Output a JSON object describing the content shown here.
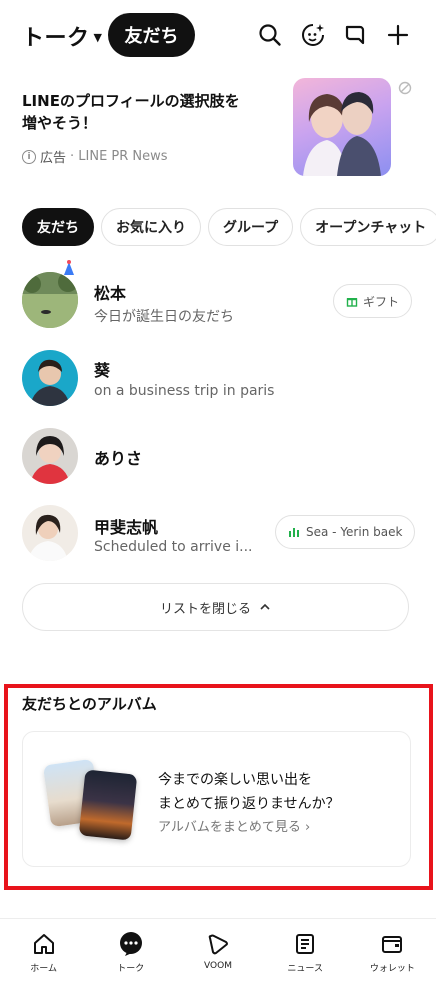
{
  "header": {
    "title": "トーク",
    "active_pill": "友だち"
  },
  "ad": {
    "headline": "LINEのプロフィールの選択肢を増やそう！",
    "label": "広告",
    "sponsor": "· LINE PR News"
  },
  "filters": [
    "友だち",
    "お気に入り",
    "グループ",
    "オープンチャット"
  ],
  "friends": [
    {
      "name": "松本",
      "status": "今日が誕生日の友だち",
      "side": "ギフト"
    },
    {
      "name": "葵",
      "status": "on a business trip in paris",
      "side": ""
    },
    {
      "name": "ありさ",
      "status": "",
      "side": ""
    },
    {
      "name": "甲斐志帆",
      "status": "Scheduled to arrive i...",
      "side": "Sea - Yerin baek"
    }
  ],
  "close_list": "リストを閉じる",
  "album": {
    "title": "友だちとのアルバム",
    "line1": "今までの楽しい思い出を",
    "line2": "まとめて振り返りませんか？",
    "link": "アルバムをまとめて見る"
  },
  "nav": [
    {
      "label": "ホーム",
      "icon": "home-icon"
    },
    {
      "label": "トーク",
      "icon": "chat-icon"
    },
    {
      "label": "VOOM",
      "icon": "voom-icon"
    },
    {
      "label": "ニュース",
      "icon": "news-icon"
    },
    {
      "label": "ウォレット",
      "icon": "wallet-icon"
    }
  ],
  "colors": {
    "highlight_frame": "#e8131b",
    "active": "#111111",
    "gift_green": "#22b14c",
    "music_green": "#22b14c"
  }
}
